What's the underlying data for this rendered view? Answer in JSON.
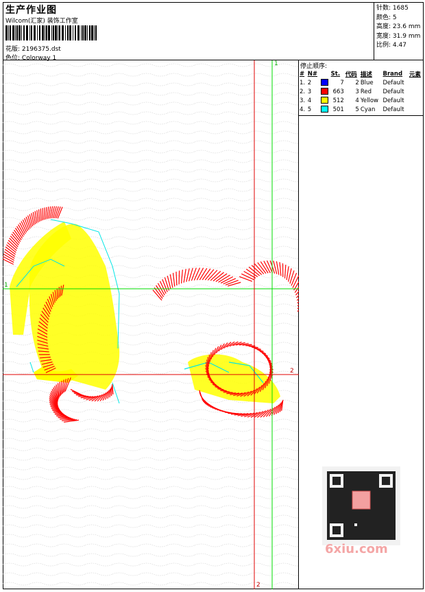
{
  "header": {
    "title": "生产作业图",
    "company": "Wilcom(汇家) 装饰工作室",
    "design_label": "花版:",
    "design_file": "2196375.dst",
    "colorway_label": "色位:",
    "colorway": "Colorway 1"
  },
  "stats": [
    {
      "label": "针数:",
      "value": "1685"
    },
    {
      "label": "颜色:",
      "value": "5"
    },
    {
      "label": "高度:",
      "value": "23.6 mm"
    },
    {
      "label": "宽度:",
      "value": "31.9 mm"
    },
    {
      "label": "比例:",
      "value": "4.47"
    }
  ],
  "stop_sequence": {
    "title": "停止顺序:",
    "columns": [
      "#",
      "N#",
      "St.",
      "代码",
      "描述",
      "Brand",
      "元素"
    ],
    "rows": [
      {
        "num": "1.",
        "n": "2",
        "color": "#0000ff",
        "st": "7",
        "code": "2",
        "desc": "Blue",
        "brand": "Default"
      },
      {
        "num": "2.",
        "n": "3",
        "color": "#ff0000",
        "st": "663",
        "code": "3",
        "desc": "Red",
        "brand": "Default"
      },
      {
        "num": "3.",
        "n": "4",
        "color": "#ffff00",
        "st": "512",
        "code": "4",
        "desc": "Yellow",
        "brand": "Default"
      },
      {
        "num": "4.",
        "n": "5",
        "color": "#00ffff",
        "st": "501",
        "code": "5",
        "desc": "Cyan",
        "brand": "Default"
      }
    ]
  },
  "guides": {
    "label_1": "1",
    "label_2_right": "2",
    "label_2_bottom": "2",
    "label_1_left": "1"
  },
  "colors": {
    "red": "#ff0000",
    "yellow": "#ffff00",
    "cyan": "#00e5e5",
    "green": "#00dd00",
    "guide_red": "#e00000"
  },
  "watermark": "6xiu.com"
}
